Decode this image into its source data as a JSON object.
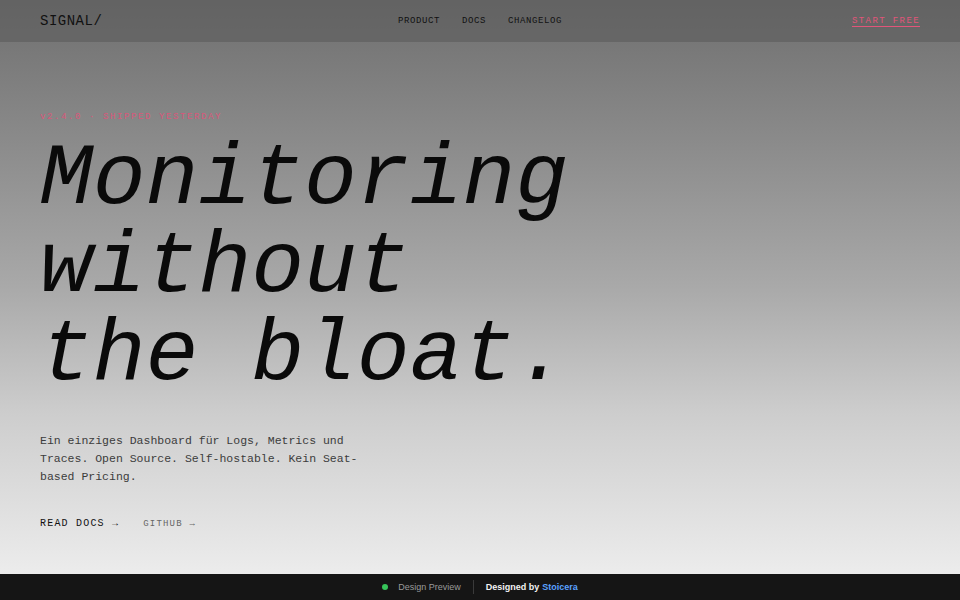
{
  "nav": {
    "logo": "SIGNAL/",
    "links": [
      "PRODUCT",
      "DOCS",
      "CHANGELOG"
    ],
    "cta": "START FREE"
  },
  "hero": {
    "eyebrow": "v2.4.0 · SHIPPED YESTERDAY",
    "headline": [
      "Monitoring",
      "without",
      "the bloat."
    ],
    "description": "Ein einziges Dashboard für Logs, Metrics und Traces. Open Source. Self-hostable. Kein Seat-based Pricing.",
    "actions": [
      {
        "label": "READ DOCS →",
        "kind": "primary"
      },
      {
        "label": "GITHUB →",
        "kind": "secondary"
      }
    ]
  },
  "footer": {
    "status": "Design Preview",
    "credit_prefix": "Designed by",
    "credit_name": "Stoicera"
  }
}
